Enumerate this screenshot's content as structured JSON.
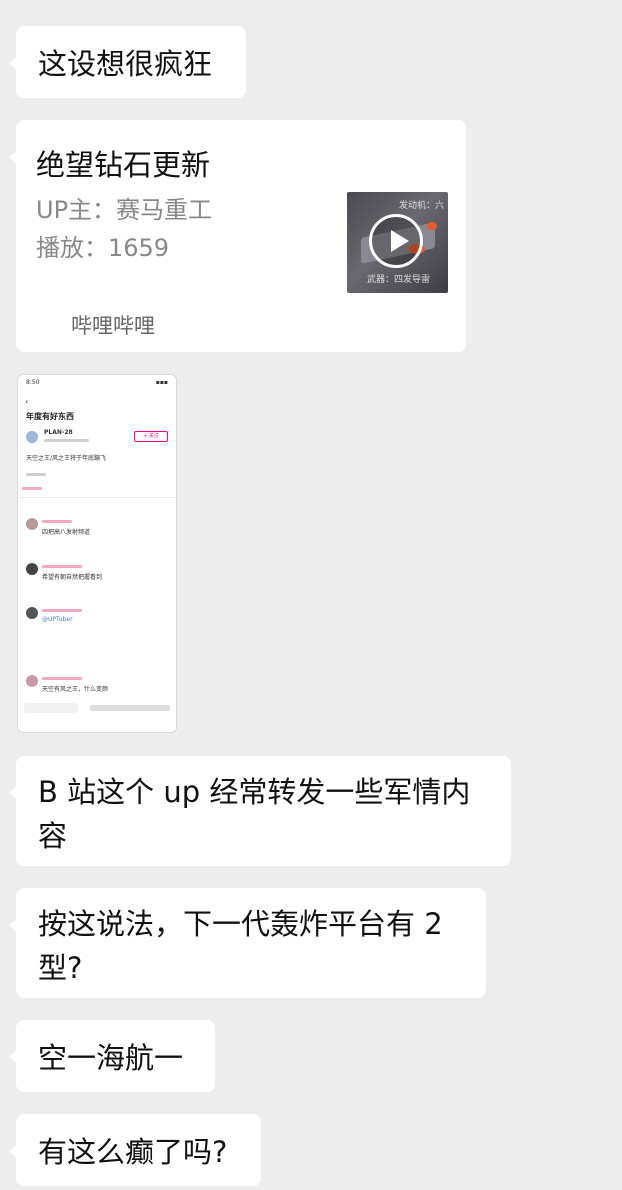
{
  "messages": [
    {
      "text": "这设想很疯狂"
    },
    {
      "card": {
        "title": "绝望钻石更新",
        "uploader": "UP主：赛马重工",
        "plays": "播放：1659",
        "source": "哔哩哔哩",
        "thumb_top_text": "发动机：六",
        "thumb_bottom_text": "武器：四发导雷",
        "icon": "play-icon"
      }
    },
    {
      "image": {
        "time": "8:50",
        "title": "年度有好东西",
        "user": "PLAN-28",
        "follow": "+ 关注",
        "caption": "天空之王/风之王将于年底蹦飞",
        "comment_1": "四把高八发射频道",
        "comment_2": "希望有朝自然把握看到",
        "comment_3": "@UPTuber",
        "comment_4": "天空有风之王，什么变颜"
      }
    },
    {
      "text": "B 站这个 up 经常转发一些军情内容"
    },
    {
      "text": "按这说法，下一代轰炸平台有 2 型?"
    },
    {
      "text": "空一海航一"
    },
    {
      "text": "有这么癫了吗?"
    }
  ],
  "colors": {
    "background": "#ededed",
    "bubble": "#ffffff",
    "text": "#111111",
    "meta_text": "#888888"
  }
}
